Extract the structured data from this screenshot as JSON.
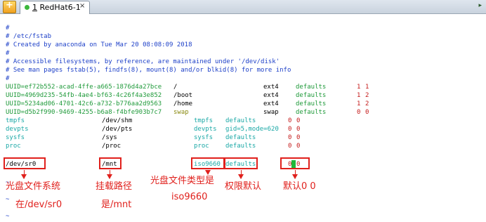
{
  "tabbar": {
    "tab_number": "1",
    "tab_title": "RedHat6-1",
    "close_glyph": "×",
    "add_glyph": "+",
    "scroll_glyph": "▸"
  },
  "terminal": {
    "comments": [
      "#",
      "# /etc/fstab",
      "# Created by anaconda on Tue Mar 20 08:08:09 2018",
      "#",
      "# Accessible filesystems, by reference, are maintained under '/dev/disk'",
      "# See man pages fstab(5), findfs(8), mount(8) and/or blkid(8) for more info",
      "#"
    ],
    "entries": [
      {
        "device": "UUID=ef72b552-acad-4ffe-a665-1876d4a27bce",
        "mount": "/",
        "type": "ext4",
        "options": "defaults",
        "dump": "1",
        "pass": "1"
      },
      {
        "device": "UUID=4969d235-54fb-4ae4-bf63-4c26f4a3e852",
        "mount": "/boot",
        "type": "ext4",
        "options": "defaults",
        "dump": "1",
        "pass": "2"
      },
      {
        "device": "UUID=5234ad06-4701-42c6-a732-b776aa2d9563",
        "mount": "/home",
        "type": "ext4",
        "options": "defaults",
        "dump": "1",
        "pass": "2"
      },
      {
        "device": "UUID=d5b2f990-9469-4255-b6a8-f4bfe903b7c7",
        "mount": "swap",
        "type": "swap",
        "options": "defaults",
        "dump": "0",
        "pass": "0"
      },
      {
        "device": "tmpfs",
        "mount": "/dev/shm",
        "type": "tmpfs",
        "options": "defaults",
        "dump": "0",
        "pass": "0"
      },
      {
        "device": "devpts",
        "mount": "/dev/pts",
        "type": "devpts",
        "options": "gid=5,mode=620",
        "dump": "0",
        "pass": "0"
      },
      {
        "device": "sysfs",
        "mount": "/sys",
        "type": "sysfs",
        "options": "defaults",
        "dump": "0",
        "pass": "0"
      },
      {
        "device": "proc",
        "mount": "/proc",
        "type": "proc",
        "options": "defaults",
        "dump": "0",
        "pass": "0"
      },
      {
        "device": "/dev/sr0",
        "mount": "/mnt",
        "type": "iso9660",
        "options": "defaults",
        "dump": "0",
        "pass": "0"
      }
    ],
    "tildes": [
      "~",
      "~",
      "~"
    ]
  },
  "annotations": {
    "device": "光盘文件系统",
    "device_sub": "在/dev/sr0",
    "mount": "挂载路径",
    "mount_sub": "是/mnt",
    "type": "光盘文件类型是",
    "type_sub": "iso9660",
    "options": "权限默认",
    "dumppass": "默认0 0"
  },
  "colors": {
    "comment": "#1c3fc8",
    "uuid": "#1f9a3a",
    "fs_cyan": "#1aa8a6",
    "number": "#c41a1a",
    "annotation": "#e0201c",
    "cursor": "#1fb83a"
  }
}
